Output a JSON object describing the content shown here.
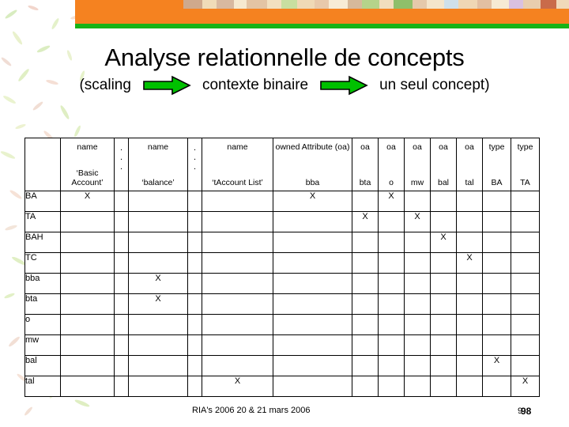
{
  "banner": {
    "orange_color": "#F58220",
    "green_color": "#17B317"
  },
  "title": {
    "main": "Analyse relationnelle de concepts",
    "subtitle_start": "(scaling",
    "subtitle_middle": "contexte binaire",
    "subtitle_end": "un seul concept)",
    "arrow_color": "#00C000"
  },
  "matrix": {
    "corner_label": "",
    "columns": [
      {
        "top": "name",
        "bottom": "‘Basic Account’",
        "kind": "name"
      },
      {
        "top": "⋮",
        "bottom": "",
        "kind": "dots"
      },
      {
        "top": "name",
        "bottom": "‘balance’",
        "kind": "name"
      },
      {
        "top": "⋮",
        "bottom": "",
        "kind": "dots"
      },
      {
        "top": "name",
        "bottom": "‘tAccount List’",
        "kind": "name"
      },
      {
        "top": "owned Attribute (oa)",
        "bottom": "bba",
        "kind": "oaH"
      },
      {
        "top": "oa",
        "bottom": "bta",
        "kind": "oa"
      },
      {
        "top": "oa",
        "bottom": "o",
        "kind": "oa"
      },
      {
        "top": "oa",
        "bottom": "mw",
        "kind": "oa"
      },
      {
        "top": "oa",
        "bottom": "bal",
        "kind": "oa"
      },
      {
        "top": "oa",
        "bottom": "tal",
        "kind": "oa"
      },
      {
        "top": "type",
        "bottom": "BA",
        "kind": "type"
      },
      {
        "top": "type",
        "bottom": "TA",
        "kind": "type"
      }
    ],
    "rows": [
      {
        "label": "BA",
        "cells": [
          "X",
          "",
          "",
          "",
          "",
          "X",
          "",
          "X",
          "",
          "",
          "",
          "",
          ""
        ]
      },
      {
        "label": "TA",
        "cells": [
          "",
          "",
          "",
          "",
          "",
          "",
          "X",
          "",
          "X",
          "",
          "",
          "",
          ""
        ]
      },
      {
        "label": "BAH",
        "cells": [
          "",
          "",
          "",
          "",
          "",
          "",
          "",
          "",
          "",
          "X",
          "",
          "",
          ""
        ]
      },
      {
        "label": "TC",
        "cells": [
          "",
          "",
          "",
          "",
          "",
          "",
          "",
          "",
          "",
          "",
          "X",
          "",
          ""
        ]
      },
      {
        "label": "bba",
        "cells": [
          "",
          "",
          "X",
          "",
          "",
          "",
          "",
          "",
          "",
          "",
          "",
          "",
          ""
        ]
      },
      {
        "label": "bta",
        "cells": [
          "",
          "",
          "X",
          "",
          "",
          "",
          "",
          "",
          "",
          "",
          "",
          "",
          ""
        ]
      },
      {
        "label": "o",
        "cells": [
          "",
          "",
          "",
          "",
          "",
          "",
          "",
          "",
          "",
          "",
          "",
          "",
          ""
        ]
      },
      {
        "label": "mw",
        "cells": [
          "",
          "",
          "",
          "",
          "",
          "",
          "",
          "",
          "",
          "",
          "",
          "",
          ""
        ]
      },
      {
        "label": "bal",
        "cells": [
          "",
          "",
          "",
          "",
          "",
          "",
          "",
          "",
          "",
          "",
          "",
          "X",
          ""
        ]
      },
      {
        "label": "tal",
        "cells": [
          "",
          "",
          "",
          "",
          "X",
          "",
          "",
          "",
          "",
          "",
          "",
          "",
          "X"
        ]
      }
    ],
    "highlight_color": "#00C000",
    "highlighted_cells": [
      [
        4,
        2
      ],
      [
        5,
        2
      ]
    ]
  },
  "footer": {
    "text": "RIA's 2006 20 & 21 mars 2006",
    "page_number": "98",
    "page_number_underlay": "9"
  }
}
